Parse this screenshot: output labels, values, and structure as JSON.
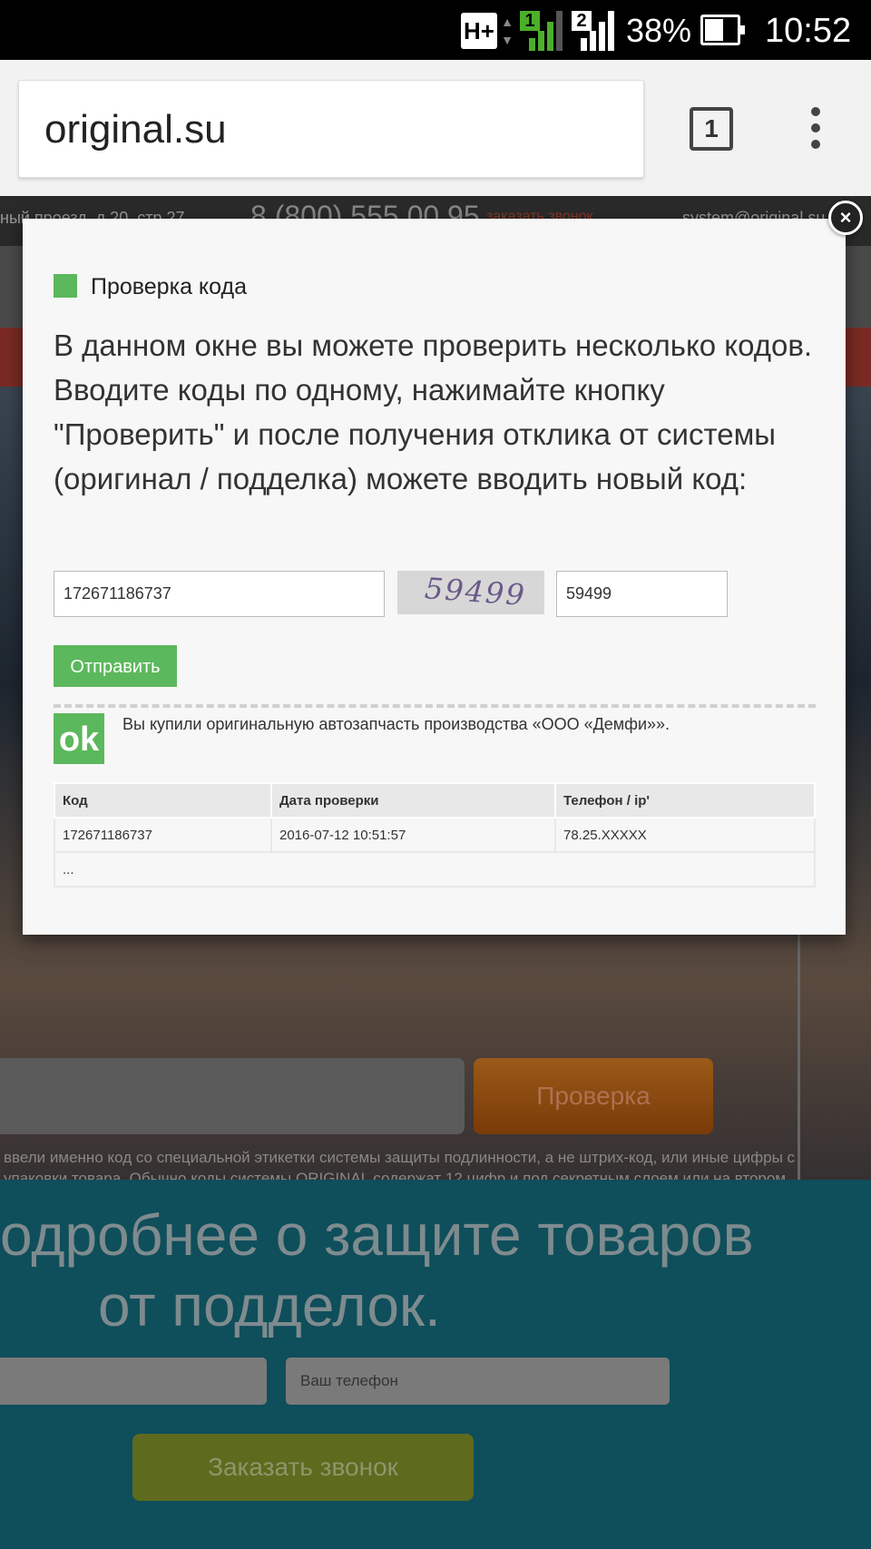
{
  "status_bar": {
    "network": "H+",
    "sim1": "1",
    "sim2": "2",
    "battery": "38%",
    "time": "10:52"
  },
  "browser": {
    "url": "original.su",
    "tab_count": "1",
    "menu_icon": "overflow-menu-icon"
  },
  "background_page": {
    "address": "ный проезд, д.20, стр.27",
    "phone": "8 (800) 555 00 95",
    "callback_link": "заказать звонок",
    "email": "system@original.su",
    "check_button": "Проверка",
    "note": "ввели именно код со специальной этикетки системы защиты подлинности, а не штрих-код, или иные цифры с упаковки товара. Обычно коды системы ORIGINAL содержат 12 цифр и под секретным слоем или на втором слое двухслойной этикетки (есть исключения).",
    "promo_heading_line1": "одробнее о защите товаров",
    "promo_heading_line2": "от подделок.",
    "phone_placeholder": "Ваш телефон",
    "order_call_button": "Заказать звонок"
  },
  "modal": {
    "title": "Проверка кода",
    "description": "В данном окне вы можете проверить несколько кодов. Вводите коды по одному, нажимайте кнопку \"Проверить\" и после получения отклика от системы (оригинал / подделка) можете вводить новый код:",
    "code_value": "172671186737",
    "captcha_text": "59499",
    "captcha_value": "59499",
    "send_button": "Отправить",
    "ok_badge": "ok",
    "result_message": "Вы купили оригинальную автозапчасть производства «ООО «Демфи»».",
    "table": {
      "headers": [
        "Код",
        "Дата проверки",
        "Телефон / ip'"
      ],
      "rows": [
        [
          "172671186737",
          "2016-07-12 10:51:57",
          "78.25.XXXXX"
        ]
      ],
      "more": "..."
    },
    "close_label": "×"
  },
  "colors": {
    "accent_green": "#5cb85c",
    "status_bar": "#000000",
    "chrome": "#f2f2f2"
  }
}
